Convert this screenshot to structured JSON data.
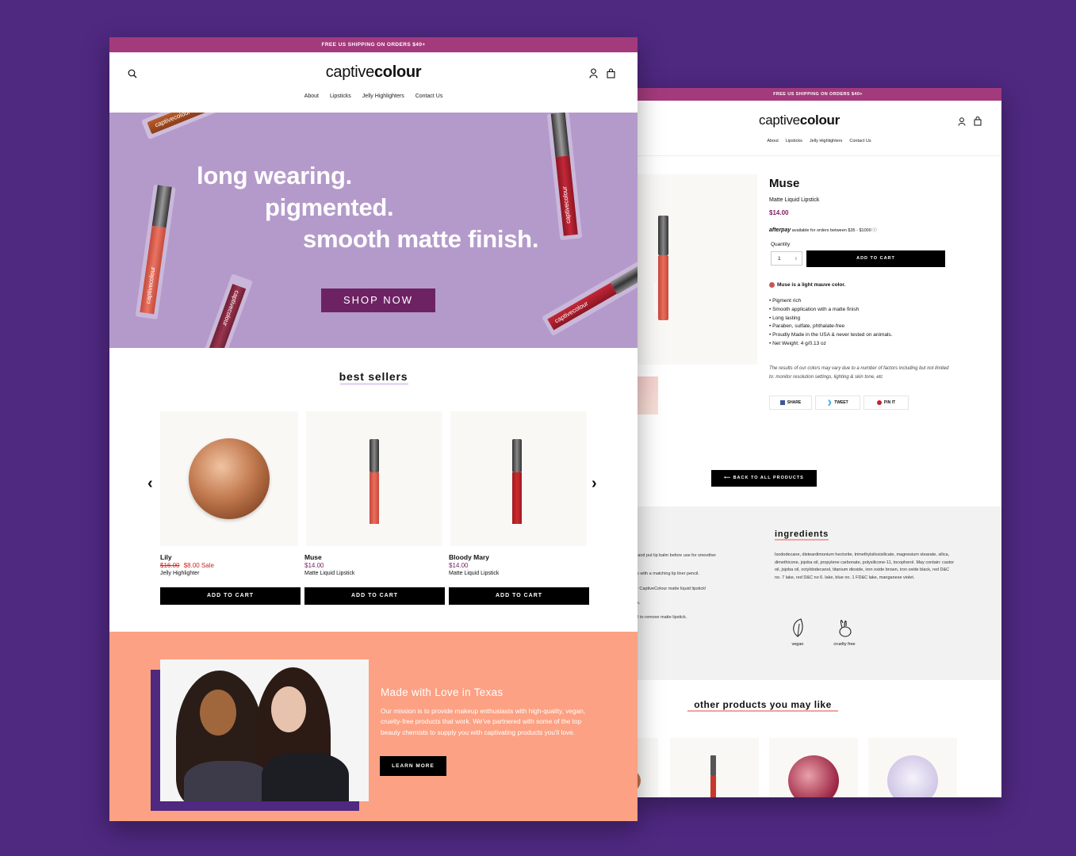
{
  "left": {
    "banner": "FREE US SHIPPING ON ORDERS $40+",
    "logo": {
      "light": "captive",
      "bold": "colour"
    },
    "nav": [
      "About",
      "Lipsticks",
      "Jelly Highlighters",
      "Contact Us"
    ],
    "hero": {
      "line1": "long wearing.",
      "line2": "pigmented.",
      "line3": "smooth matte finish.",
      "cta": "SHOP NOW",
      "tube_label": "captivecolour"
    },
    "best_sellers": {
      "title": "best sellers",
      "prev": "‹",
      "next": "›",
      "products": [
        {
          "name": "Lily",
          "price_old": "$16.00",
          "price_sale": "$8.00 Sale",
          "type": "Jelly Highlighter",
          "cta": "ADD TO CART"
        },
        {
          "name": "Muse",
          "price": "$14.00",
          "type": "Matte Liquid Lipstick",
          "cta": "ADD TO CART"
        },
        {
          "name": "Bloody Mary",
          "price": "$14.00",
          "type": "Matte Liquid Lipstick",
          "cta": "ADD TO CART"
        }
      ]
    },
    "about": {
      "title": "Made with Love in Texas",
      "body": "Our mission is to provide makeup enthusiasts with high-quality, vegan, cruelty-free products that work. We've partnered with some of the top beauty chemists to supply you with captivating products you'll love.",
      "cta": "LEARN MORE"
    }
  },
  "right": {
    "banner": "FREE US SHIPPING ON ORDERS $40+",
    "logo": {
      "light": "captive",
      "bold": "colour"
    },
    "nav": [
      "About",
      "Lipsticks",
      "Jelly Highlighters",
      "Contact Us"
    ],
    "product": {
      "title": "Muse",
      "subtitle": "Matte Liquid Lipstick",
      "price": "$14.00",
      "afterpay_brand": "afterpay",
      "afterpay_text": "available for orders between $35 - $1000 ⓘ",
      "quantity_label": "Quantity",
      "quantity_value": "1",
      "add_to_cart": "ADD TO CART",
      "color_note": "Muse is a light mauve color.",
      "bullets": [
        "• Pigment rich",
        "• Smooth application with a matte finish",
        "• Long lasting",
        "• Paraben, sulfate, phthalate-free",
        "• Proudly Made in the USA & never tested on animals.",
        "• Net Weight: 4 g/0.13 oz"
      ],
      "disclaimer": "The results of our colors may vary due to a number of factors including but not limited to: monitor resolution settings, lighting & skin tone, etc",
      "share": [
        "SHARE",
        "TWEET",
        "PIN IT"
      ],
      "back": "BACK TO ALL PRODUCTS",
      "tube_label": "captivecolour"
    },
    "how_to": [
      "s and put lip balm before use for smoother",
      "ps with a matching lip liner pencil.",
      "ur CaptiveColour matte liquid lipstick!",
      "ds.",
      "oil to remove matte lipstick."
    ],
    "ingredients": {
      "title": "ingredients",
      "text": "Isododecane, disteardimonium hectorite, trimethylsiloxisilicate, magnesium stearate, silica, dimethicone, jojoba oil, propylene carbonate, polysilicone-11, tocopherol. May contain: castor oil, jojoba oil, octyldodecanol, titanium dioxide, iron oxide brown, iron oxide black, red D&C no. 7 lake, red D&C no 6. lake, blue no. 1 FD&C lake, manganese violet.",
      "badges": [
        "vegan",
        "cruelty free"
      ]
    },
    "other": {
      "title": "other products you may like"
    }
  },
  "colors": {
    "background": "#4f2880",
    "banner": "#a33a7c",
    "hero": "#b49aca",
    "cta_purple": "#6d2363",
    "about_bg": "#fca183",
    "sale": "#d32020",
    "price": "#7b2366"
  }
}
